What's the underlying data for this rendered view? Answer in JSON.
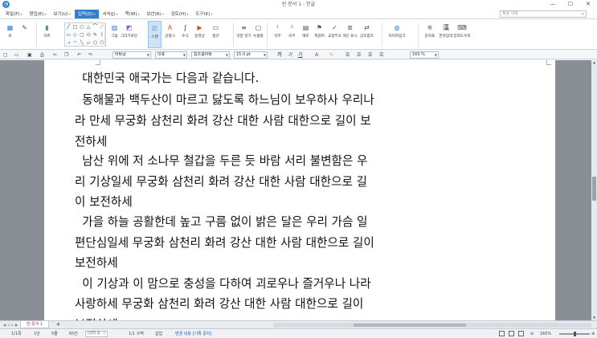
{
  "window": {
    "title": "빈 문서 1 - 한글",
    "minimize_glyph": "—",
    "maximize_glyph": "☐",
    "close_glyph": "✕"
  },
  "menu": {
    "items": [
      {
        "label": "파일(F)"
      },
      {
        "label": "편집(E)"
      },
      {
        "label": "보기(U)"
      },
      {
        "label": "입력(D)",
        "active": true
      },
      {
        "label": "서식(J)"
      },
      {
        "label": "쪽(W)"
      },
      {
        "label": "보안(R)"
      },
      {
        "label": "검토(H)"
      },
      {
        "label": "도구(K)"
      }
    ],
    "search_placeholder": "찾을 내용"
  },
  "ribbon": {
    "buttons": [
      {
        "id": "table",
        "label": "표",
        "icon": "table-icon"
      },
      {
        "id": "edit",
        "label": "",
        "icon": "pencil-icon"
      },
      {
        "id": "chart",
        "label": "차트",
        "icon": "chart-icon"
      },
      {
        "id": "picture",
        "label": "그림",
        "icon": "picture-icon"
      },
      {
        "id": "drawing",
        "label": "그리기마당",
        "icon": "drawing-icon"
      },
      {
        "id": "scan",
        "label": "스캔",
        "icon": "scan-icon",
        "selected": true
      },
      {
        "id": "textbox",
        "label": "글맵시",
        "icon": "textart-icon"
      },
      {
        "id": "formula",
        "label": "수식",
        "icon": "formula-icon"
      },
      {
        "id": "media",
        "label": "동영상",
        "icon": "video-icon"
      },
      {
        "id": "caption",
        "label": "캡션",
        "icon": "caption-icon"
      },
      {
        "id": "note",
        "label": "덧말 넣기",
        "icon": "note-icon"
      },
      {
        "id": "memo",
        "label": "누름틀",
        "icon": "field-icon"
      },
      {
        "id": "footnote",
        "label": "각주",
        "icon": "footnote-icon"
      },
      {
        "id": "endnote",
        "label": "미주",
        "icon": "endnote-icon"
      },
      {
        "id": "comment",
        "label": "메모",
        "icon": "memo-icon"
      },
      {
        "id": "bookmark",
        "label": "책갈피",
        "icon": "bookmark-icon"
      },
      {
        "id": "cross",
        "label": "교정부호",
        "icon": "proof-icon"
      },
      {
        "id": "index",
        "label": "색인 표시",
        "icon": "index-icon"
      },
      {
        "id": "ref",
        "label": "상호참조",
        "icon": "crossref-icon"
      },
      {
        "id": "hyperlink",
        "label": "하이퍼링크",
        "icon": "globe-icon"
      },
      {
        "id": "symbol",
        "label": "문자표",
        "icon": "asterisk-icon"
      },
      {
        "id": "hanja",
        "label": "한자입력",
        "icon": "hanja-icon"
      },
      {
        "id": "inputtool",
        "label": "입력도우미",
        "icon": "input-helper-icon"
      }
    ],
    "shape_glyphs": [
      "╱",
      "□",
      "○",
      "△",
      "⌒",
      "⟋",
      "▭",
      "◇",
      "▢",
      "⬭",
      "✎",
      "⌇",
      "➝",
      "◠",
      "╲",
      "▱",
      "⬡",
      "⬠"
    ]
  },
  "format_toolbar": {
    "style": "바탕글",
    "language": "대표",
    "font": "함초롬바탕",
    "size": "15.0",
    "size_unit": "pt",
    "zoom": "160",
    "zoom_unit": "%",
    "bold_glyph": "가",
    "italic_glyph": "가",
    "underline_glyph": "가"
  },
  "document": {
    "lines": [
      "  대한민국 애국가는 다음과 같습니다.",
      "  동해물과 백두산이 마르고 닳도록 하느님이 보우하사 우리나",
      "라 만세 무궁화 삼천리 화려 강산 대한 사람 대한으로 길이 보",
      "전하세",
      "  남산 위에 저 소나무 철갑을 두른 듯 바람 서리 불변함은 우",
      "리 기상일세 무궁화 삼천리 화려 강산 대한 사람 대한으로 길",
      "이 보전하세",
      "  가을 하늘 공활한데 높고 구름 없이 밝은 달은 우리 가슴 일",
      "편단심일세 무궁화 삼천리 화려 강산 대한 사람 대한으로 길이",
      "보전하세",
      "  이 기상과 이 맘으로 충성을 다하여 괴로우나 즐거우나 나라",
      "사랑하세 무궁화 삼천리 화려 강산 대한 사람 대한으로 길이",
      "보전하세"
    ]
  },
  "tabs": {
    "doc_tab": "빈 문서 1",
    "add_tab": "+"
  },
  "status": {
    "page": "1/1쪽",
    "section": "1단",
    "line": "5줄",
    "column": "65칸",
    "input_mode": "[입력 중...]",
    "section_count": "1/1 구역",
    "insert": "삽입",
    "track": "변경 내용 [기록 중지]",
    "zoom": "165%"
  }
}
